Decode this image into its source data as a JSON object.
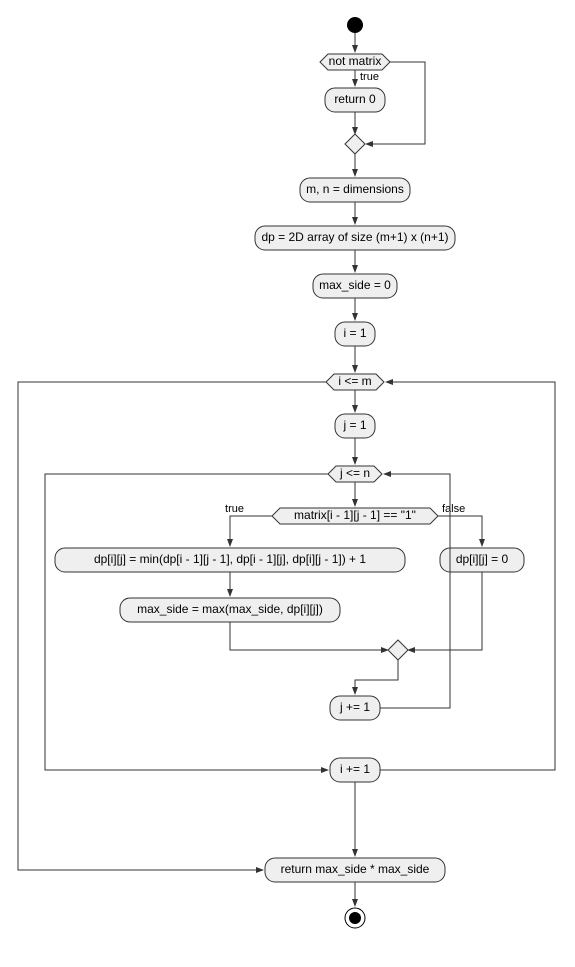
{
  "chart_data": {
    "type": "flowchart",
    "nodes": [
      {
        "id": "start",
        "type": "initial"
      },
      {
        "id": "cond1",
        "label": "not matrix",
        "type": "hexagon"
      },
      {
        "id": "ret0",
        "label": "return 0",
        "type": "action"
      },
      {
        "id": "merge1",
        "type": "diamond"
      },
      {
        "id": "dims",
        "label": "m, n = dimensions",
        "type": "action"
      },
      {
        "id": "dp",
        "label": "dp = 2D array of size (m+1) x (n+1)",
        "type": "action"
      },
      {
        "id": "maxside",
        "label": "max_side = 0",
        "type": "action"
      },
      {
        "id": "i1",
        "label": "i = 1",
        "type": "action"
      },
      {
        "id": "iloop",
        "label": "i <= m",
        "type": "hexagon"
      },
      {
        "id": "j1",
        "label": "j = 1",
        "type": "action"
      },
      {
        "id": "jloop",
        "label": "j <= n",
        "type": "hexagon"
      },
      {
        "id": "cond2",
        "label": "matrix[i - 1][j - 1] == \"1\"",
        "type": "hexagon"
      },
      {
        "id": "dpmin",
        "label": "dp[i][j] = min(dp[i - 1][j - 1], dp[i - 1][j], dp[i][j - 1]) + 1",
        "type": "action"
      },
      {
        "id": "dpzero",
        "label": "dp[i][j] = 0",
        "type": "action"
      },
      {
        "id": "maxupd",
        "label": "max_side = max(max_side, dp[i][j])",
        "type": "action"
      },
      {
        "id": "merge2",
        "type": "diamond"
      },
      {
        "id": "jinc",
        "label": "j += 1",
        "type": "action"
      },
      {
        "id": "iinc",
        "label": "i += 1",
        "type": "action"
      },
      {
        "id": "retmax",
        "label": "return max_side * max_side",
        "type": "action"
      },
      {
        "id": "end",
        "type": "final"
      }
    ],
    "edges": [
      {
        "from": "start",
        "to": "cond1"
      },
      {
        "from": "cond1",
        "to": "ret0",
        "label": "true"
      },
      {
        "from": "ret0",
        "to": "merge1"
      },
      {
        "from": "cond1",
        "to": "merge1",
        "label": "false_bypass"
      },
      {
        "from": "merge1",
        "to": "dims"
      },
      {
        "from": "dims",
        "to": "dp"
      },
      {
        "from": "dp",
        "to": "maxside"
      },
      {
        "from": "maxside",
        "to": "i1"
      },
      {
        "from": "i1",
        "to": "iloop"
      },
      {
        "from": "iloop",
        "to": "j1",
        "label": "true"
      },
      {
        "from": "j1",
        "to": "jloop"
      },
      {
        "from": "jloop",
        "to": "cond2",
        "label": "true"
      },
      {
        "from": "cond2",
        "to": "dpmin",
        "label": "true"
      },
      {
        "from": "cond2",
        "to": "dpzero",
        "label": "false"
      },
      {
        "from": "dpmin",
        "to": "maxupd"
      },
      {
        "from": "maxupd",
        "to": "merge2"
      },
      {
        "from": "dpzero",
        "to": "merge2"
      },
      {
        "from": "merge2",
        "to": "jinc"
      },
      {
        "from": "jinc",
        "to": "jloop",
        "label": "loop-back"
      },
      {
        "from": "jloop",
        "to": "iinc",
        "label": "false"
      },
      {
        "from": "iinc",
        "to": "iloop",
        "label": "loop-back"
      },
      {
        "from": "iloop",
        "to": "retmax",
        "label": "false"
      },
      {
        "from": "retmax",
        "to": "end"
      }
    ]
  },
  "labels": {
    "cond1": "not matrix",
    "ret0": "return 0",
    "dims": "m, n = dimensions",
    "dp": "dp = 2D array of size (m+1) x (n+1)",
    "maxside": "max_side = 0",
    "i1": "i = 1",
    "iloop": "i <= m",
    "j1": "j = 1",
    "jloop": "j <= n",
    "cond2": "matrix[i - 1][j - 1] == \"1\"",
    "dpmin": "dp[i][j] = min(dp[i - 1][j - 1], dp[i - 1][j], dp[i][j - 1]) + 1",
    "dpzero": "dp[i][j] = 0",
    "maxupd": "max_side = max(max_side, dp[i][j])",
    "jinc": "j += 1",
    "iinc": "i += 1",
    "retmax": "return max_side * max_side",
    "true": "true",
    "false": "false"
  }
}
